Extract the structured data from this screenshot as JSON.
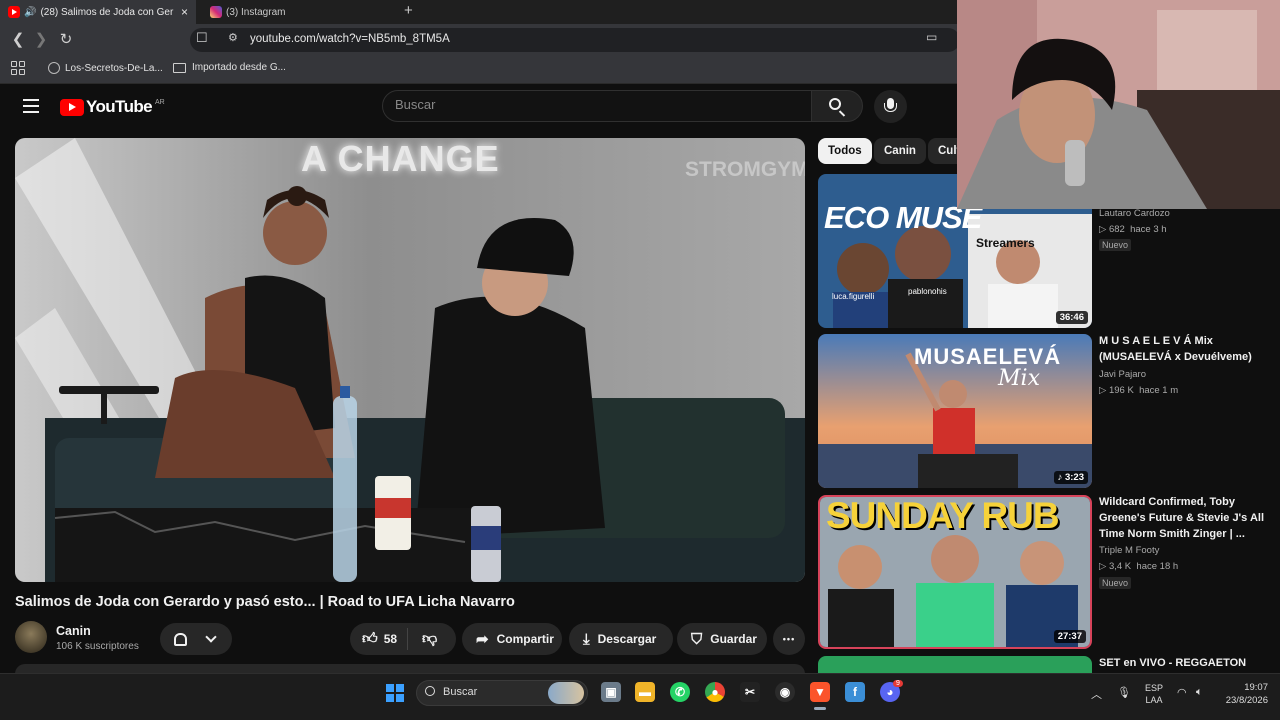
{
  "browser": {
    "tabs": [
      {
        "title": "(28) Salimos de Joda con Ger",
        "audio": true,
        "active": true
      },
      {
        "title": "(3) Instagram",
        "active": false
      }
    ],
    "new_tab_label": "+",
    "close_glyph": "×",
    "url": "youtube.com/watch?v=NB5mb_8TM5A",
    "bookmarks": [
      "Los-Secretos-De-La...",
      "Importado desde G..."
    ]
  },
  "youtube": {
    "logo_text": "YouTube",
    "country_code": "AR",
    "search_placeholder": "Buscar",
    "video": {
      "neon_sign": "A CHANGE",
      "watermark": "STROMGYM",
      "title": "Salimos de Joda con Gerardo y pasó esto... | Road to UFA Licha Navarro",
      "channel": "Canin",
      "subscribers": "106 K suscriptores",
      "likes": "58",
      "share_label": "Compartir",
      "download_label": "Descargar",
      "save_label": "Guardar",
      "more_glyph": "•••"
    },
    "chips": [
      "Todos",
      "Canin",
      "Cult"
    ],
    "related": [
      {
        "thumb_text_top": "ECO MUSE",
        "thumb_text_mid": "Streamers",
        "thumb_tags": [
          "luca.figurelli",
          "pablonohis"
        ],
        "duration": "36:46",
        "channel": "Lautaro Cardozo",
        "views": "682",
        "age": "hace 3 h",
        "badge": "Nuevo"
      },
      {
        "thumb_text_top": "MUSAELEVÁ",
        "thumb_text_mid": "Mix",
        "duration": "♪ 3:23",
        "title": "M U S A E L E V Á Mix (MUSAELEVÁ x Devuélveme)",
        "channel": "Javi Pajaro",
        "views": "196 K",
        "age": "hace 1 m"
      },
      {
        "thumb_text_top": "SUNDAY RUB",
        "duration": "27:37",
        "title": "Wildcard Confirmed, Toby Greene's Future & Stevie J's All Time Norm Smith Zinger | ...",
        "channel": "Triple M Footy",
        "views": "3,4 K",
        "age": "hace 18 h",
        "badge": "Nuevo"
      },
      {
        "title": "SET en VIVO - REGGAETON"
      }
    ]
  },
  "taskbar": {
    "search_label": "Buscar",
    "discord_badge": "9",
    "lang_line1": "ESP",
    "lang_line2": "LAA",
    "time": "19:07",
    "date": "23/8/2026"
  },
  "colors": {
    "yt_red": "#ff0000",
    "bg": "#0f0f0f",
    "pill": "#272727"
  }
}
